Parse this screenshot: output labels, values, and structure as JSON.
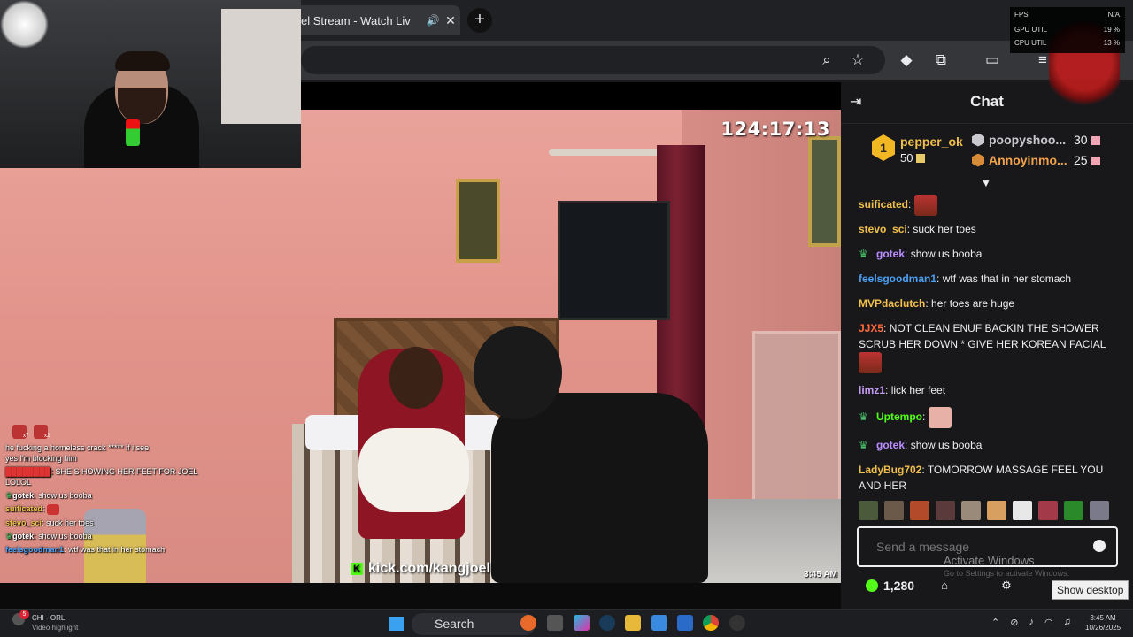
{
  "browser": {
    "tab_title": "el Stream - Watch Liv",
    "tab_audio_icon": "speaker-icon",
    "tab_close_icon": "close-icon",
    "new_tab": "+"
  },
  "video": {
    "timer": "124:17:13",
    "kick_url": "kick.com/kangjoel",
    "time": "3:45 AM"
  },
  "overlay_chat": [
    {
      "user": "",
      "text": "he fucking a homeless crack ***** if i see"
    },
    {
      "user": "",
      "text": "yes I'm blocking him"
    },
    {
      "user": "",
      "text": "SHE S HOWING HER FEET FOR JOEL LOLOL"
    },
    {
      "user": "gotek",
      "text": "show us booba"
    },
    {
      "user": "suificated",
      "text": ""
    },
    {
      "user": "stevo_sci",
      "text": "suck her toes"
    },
    {
      "user": "gotek",
      "text": "show us booba"
    },
    {
      "user": "feelsgoodman1",
      "text": "wtf was that in her stomach"
    }
  ],
  "overlay_emote_counts": [
    "x7",
    "x2"
  ],
  "chat": {
    "title": "Chat",
    "leaderboard": {
      "first": {
        "rank": "1",
        "name": "pepper_ok",
        "score": "50"
      },
      "second": {
        "name": "poopyshoo...",
        "score": "30"
      },
      "third": {
        "name": "Annoyinmo...",
        "score": "25"
      }
    },
    "messages": [
      {
        "user": "suificated",
        "text": "",
        "color": "#f2c04a",
        "badge": false
      },
      {
        "user": "stevo_sci",
        "text": "suck her toes",
        "color": "#f2c04a",
        "badge": false
      },
      {
        "user": "gotek",
        "text": "show us booba",
        "color": "#b98cff",
        "badge": true
      },
      {
        "user": "feelsgoodman1",
        "text": "wtf was that in her stomach",
        "color": "#4a9ff5",
        "badge": false
      },
      {
        "user": "MVPdaclutch",
        "text": "her toes are huge",
        "color": "#f2c04a",
        "badge": false
      },
      {
        "user": "JJX5",
        "text": "NOT CLEAN ENUF BACKIN THE SHOWER SCRUB HER DOWN * GIVE HER KOREAN FACIAL",
        "color": "#ff6b3b",
        "badge": false
      },
      {
        "user": "limz1",
        "text": "lick her feet",
        "color": "#c69bf5",
        "badge": false
      },
      {
        "user": "Uptempo",
        "text": "",
        "color": "#53fc18",
        "badge": true
      },
      {
        "user": "gotek",
        "text": "show us booba",
        "color": "#b98cff",
        "badge": true
      },
      {
        "user": "LadyBug702",
        "text": "TOMORROW MASSAGE FEEL YOU AND HER",
        "color": "#f2c04a",
        "badge": false
      }
    ],
    "input_placeholder": "Send a message",
    "activate_title": "Activate Windows",
    "activate_sub": "Go to Settings to activate Windows.",
    "kicks_count": "1,280",
    "show_desktop": "Show desktop"
  },
  "perf": {
    "fps_label": "FPS",
    "fps_value": "N/A",
    "gpu_label": "GPU UTIL",
    "gpu_value": "19 %",
    "cpu_label": "CPU UTIL",
    "cpu_value": "13 %"
  },
  "taskbar": {
    "notif_title": "CHI - ORL",
    "notif_sub": "Video highlight",
    "notif_badge": "5",
    "search": "Search",
    "time": "3:45 AM",
    "date": "10/26/2025"
  }
}
